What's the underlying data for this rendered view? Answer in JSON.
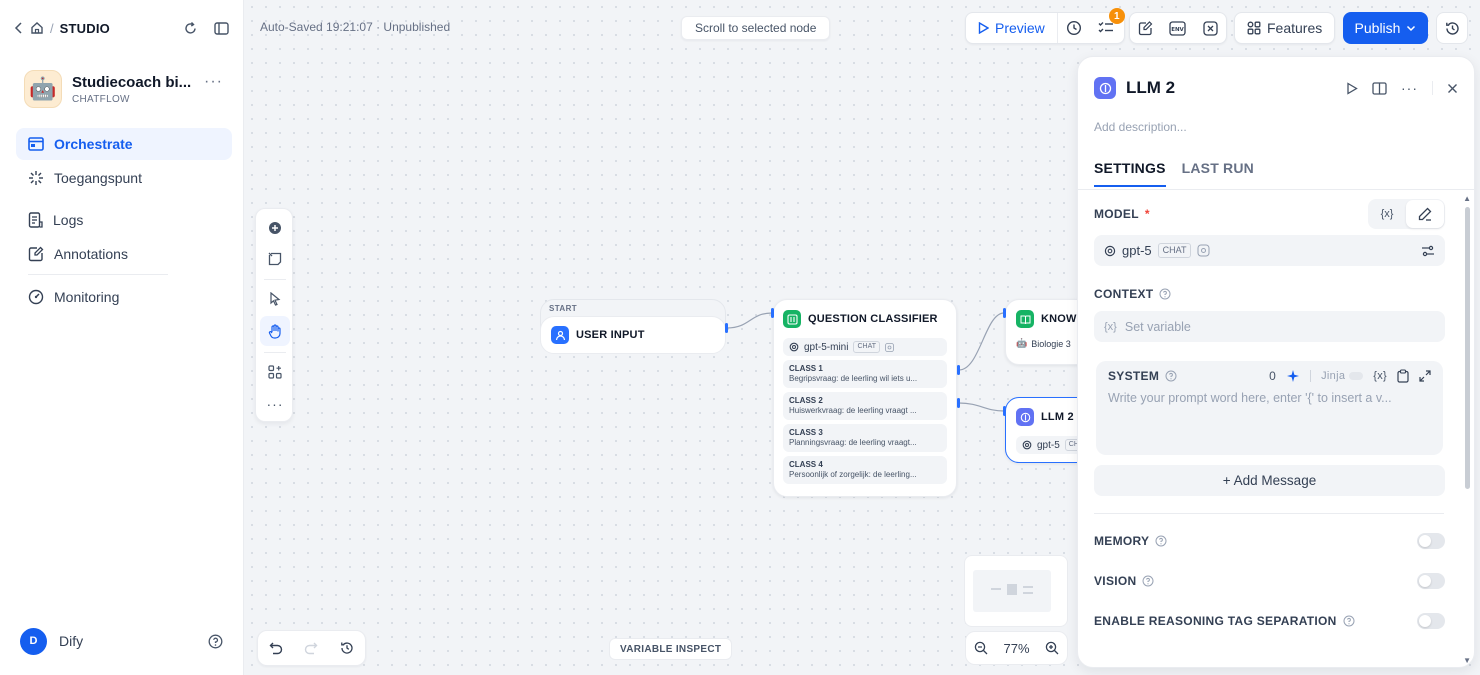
{
  "sidebar": {
    "studio": "STUDIO",
    "app_name": "Studiecoach bi...",
    "app_type": "CHATFLOW",
    "app_emoji": "🤖",
    "nav": [
      {
        "label": "Orchestrate",
        "icon": "window-icon",
        "active": true
      },
      {
        "label": "Toegangspunt",
        "icon": "sparkle-icon"
      },
      {
        "label": "Logs",
        "icon": "document-icon"
      },
      {
        "label": "Annotations",
        "icon": "annotation-icon"
      },
      {
        "label": "Monitoring",
        "icon": "gauge-icon"
      }
    ],
    "user_initial": "D",
    "user_name": "Dify"
  },
  "canvas": {
    "autosave": "Auto-Saved 19:21:07 · Unpublished",
    "scroll_to_selected": "Scroll to selected node",
    "variable_inspect": "VARIABLE INSPECT",
    "zoom": "77%"
  },
  "toolbar": {
    "preview": "Preview",
    "badge_count": "1",
    "env_label": "ENV",
    "features": "Features",
    "publish": "Publish"
  },
  "nodes": {
    "start_label": "START",
    "user_input": "USER INPUT",
    "qc_title": "QUESTION CLASSIFIER",
    "qc_model": "gpt-5-mini",
    "chat_tag": "CHAT",
    "classes": [
      {
        "title": "CLASS 1",
        "desc": "Begripsvraag: de leerling wil iets u..."
      },
      {
        "title": "CLASS 2",
        "desc": "Huiswerkvraag: de leerling vraagt ..."
      },
      {
        "title": "CLASS 3",
        "desc": "Planningsvraag: de leerling vraagt..."
      },
      {
        "title": "CLASS 4",
        "desc": "Persoonlijk of zorgelijk: de leerling..."
      }
    ],
    "knowledge_title": "KNOWL",
    "knowledge_item": "Biologie 3",
    "llm2_title": "LLM 2",
    "llm2_model": "gpt-5",
    "llm2_tag": "CH"
  },
  "panel": {
    "title": "LLM 2",
    "description_placeholder": "Add description...",
    "tabs": [
      "SETTINGS",
      "LAST RUN"
    ],
    "model_label": "MODEL",
    "required_mark": "*",
    "var_token": "{x}",
    "model_name": "gpt-5",
    "model_tag": "CHAT",
    "context_label": "CONTEXT",
    "context_placeholder": "Set variable",
    "system_label": "SYSTEM",
    "system_count": "0",
    "jinja_label": "Jinja",
    "system_placeholder": "Write your prompt word here, enter '{' to insert a v...",
    "add_message": "+ Add Message",
    "memory_label": "MEMORY",
    "vision_label": "VISION",
    "reasoning_label": "ENABLE REASONING TAG SEPARATION"
  },
  "colors": {
    "accent": "#155eef",
    "badge": "#f79009",
    "qc_green": "#16b364",
    "llm_indigo": "#6172f3"
  }
}
